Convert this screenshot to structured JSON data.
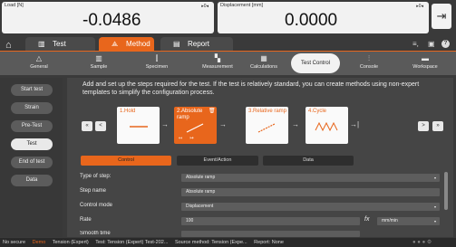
{
  "readouts": {
    "load": {
      "label": "Load [N]",
      "value": "-0.0486",
      "controls": "▸0◂"
    },
    "displacement": {
      "label": "Displacement [mm]",
      "value": "0.0000",
      "controls": "▸0◂"
    }
  },
  "icons": {
    "exit": "exit-icon",
    "home": "home-icon"
  },
  "top_tabs": [
    {
      "label": "Test",
      "icon": "test-icon"
    },
    {
      "label": "Method",
      "icon": "method-icon"
    },
    {
      "label": "Report",
      "icon": "report-icon"
    }
  ],
  "top_right_icons": {
    "list": "≡,",
    "save": "🖫",
    "help": "?"
  },
  "toolbar": [
    {
      "label": "General",
      "icon": "△"
    },
    {
      "label": "Sample",
      "icon": "▥"
    },
    {
      "label": "Specimen",
      "icon": "⫿"
    },
    {
      "label": "Measurement",
      "icon": "▚"
    },
    {
      "label": "Calculations",
      "icon": "▦"
    },
    {
      "label": "Test Control",
      "icon": ""
    },
    {
      "label": "Console",
      "icon": "⫶"
    },
    {
      "label": "Workspace",
      "icon": "▬"
    }
  ],
  "sidebar": [
    {
      "label": "Start test"
    },
    {
      "label": "Strain"
    },
    {
      "label": "Pre-Test"
    },
    {
      "label": "Test"
    },
    {
      "label": "End of test"
    },
    {
      "label": "Data"
    }
  ],
  "intro_text": "Add and set up the steps required for the test. If the test is relatively standard, you can create methods using non-expert templates to simplify the configuration process.",
  "nav": {
    "first": "«",
    "prev": "<",
    "next": ">",
    "last": "»"
  },
  "steps": [
    {
      "name": "1.Hold"
    },
    {
      "name": "2.Absolute ramp"
    },
    {
      "name": "3.Relative ramp"
    },
    {
      "name": "4.Cycle"
    }
  ],
  "section_tabs": [
    "Control",
    "Event/Action",
    "Data"
  ],
  "properties": [
    {
      "label": "Type of step:",
      "value": "Absolute ramp"
    },
    {
      "label": "Step name",
      "value": "Absolute ramp"
    },
    {
      "label": "Control mode",
      "value": "Displacement"
    },
    {
      "label": "Rate",
      "value": "100",
      "unit": "mm/min"
    },
    {
      "label": "Smooth time",
      "value": ""
    }
  ],
  "status_bar": [
    "No secure",
    "Demo",
    "Tension (Expert)",
    "Test: Tension (Expert) Test-202...",
    "Source method: Tension (Expe...",
    "Report: None"
  ],
  "colors": {
    "accent": "#e8661c",
    "demo": "#e8661c"
  }
}
